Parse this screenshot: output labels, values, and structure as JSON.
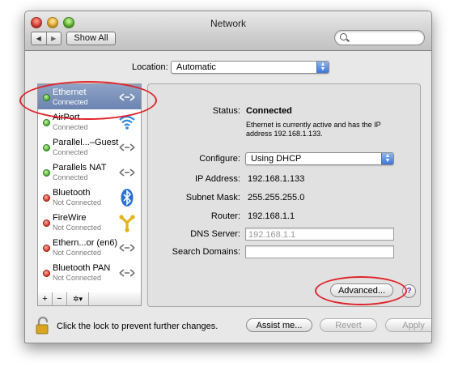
{
  "window": {
    "title": "Network"
  },
  "toolbar": {
    "back_label": "◀",
    "forward_label": "▶",
    "show_all_label": "Show All",
    "search_placeholder": ""
  },
  "location": {
    "label": "Location:",
    "value": "Automatic"
  },
  "services": [
    {
      "name": "Ethernet",
      "status": "Connected",
      "dot": "green",
      "icon": "ethernet-icon",
      "selected": true
    },
    {
      "name": "AirPort",
      "status": "Connected",
      "dot": "green",
      "icon": "wifi-icon",
      "selected": false
    },
    {
      "name": "Parallel...–Guest",
      "status": "Connected",
      "dot": "green",
      "icon": "ethernet-icon",
      "selected": false
    },
    {
      "name": "Parallels NAT",
      "status": "Connected",
      "dot": "green",
      "icon": "ethernet-icon",
      "selected": false
    },
    {
      "name": "Bluetooth",
      "status": "Not Connected",
      "dot": "red",
      "icon": "bluetooth-icon",
      "selected": false
    },
    {
      "name": "FireWire",
      "status": "Not Connected",
      "dot": "red",
      "icon": "firewire-icon",
      "selected": false
    },
    {
      "name": "Ethern...or (en6)",
      "status": "Not Connected",
      "dot": "red",
      "icon": "ethernet-icon",
      "selected": false
    },
    {
      "name": "Bluetooth PAN",
      "status": "Not Connected",
      "dot": "red",
      "icon": "ethernet-icon",
      "selected": false
    }
  ],
  "sidebar_toolbar": {
    "add_label": "+",
    "remove_label": "−",
    "action_label": "✲▾"
  },
  "detail": {
    "status_label": "Status:",
    "status_value": "Connected",
    "status_desc_1": "Ethernet is currently active and has the IP",
    "status_desc_2": "address 192.168.1.133.",
    "configure_label": "Configure:",
    "configure_value": "Using DHCP",
    "ip_label": "IP Address:",
    "ip_value": "192.168.1.133",
    "mask_label": "Subnet Mask:",
    "mask_value": "255.255.255.0",
    "router_label": "Router:",
    "router_value": "192.168.1.1",
    "dns_label": "DNS Server:",
    "dns_placeholder": "192.168.1.1",
    "search_domains_label": "Search Domains:",
    "search_domains_value": "",
    "advanced_label": "Advanced...",
    "help_label": "?"
  },
  "footer": {
    "lock_text": "Click the lock to prevent further changes.",
    "assist_label": "Assist me...",
    "revert_label": "Revert",
    "apply_label": "Apply"
  },
  "colors": {
    "annotation": "#e0242b",
    "selection": "#7088b3",
    "accent": "#3d78d8"
  }
}
